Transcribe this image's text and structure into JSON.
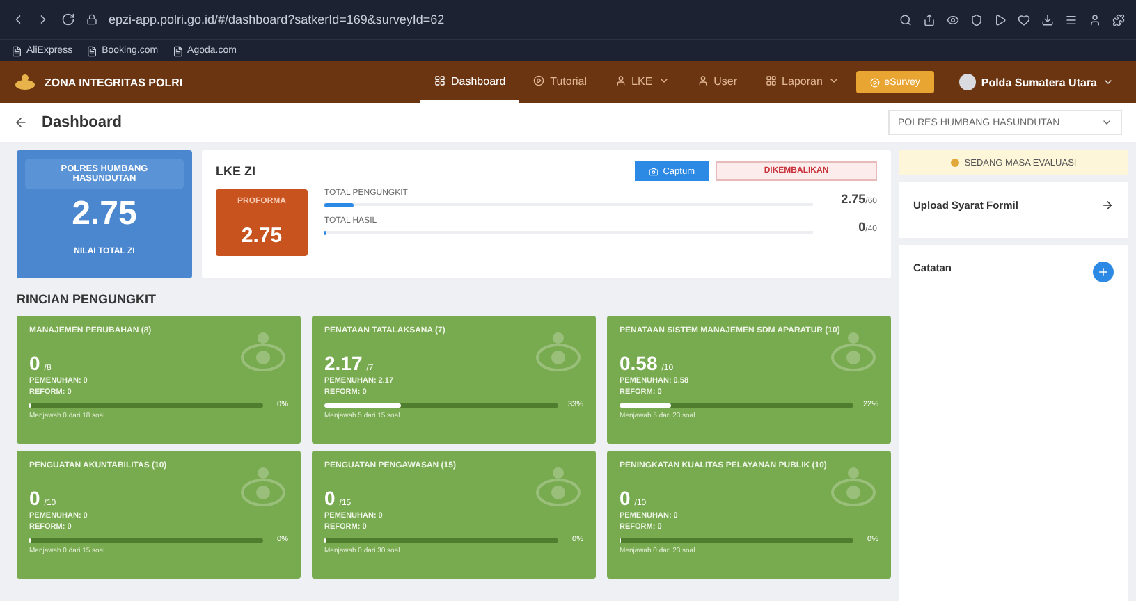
{
  "browser": {
    "address": "epzi-app.polri.go.id/#/dashboard?satkerId=169&surveyId=62",
    "bookmarks": [
      "AliExpress",
      "Booking.com",
      "Agoda.com"
    ]
  },
  "navbar": {
    "brand": "ZONA INTEGRITAS POLRI",
    "menu": [
      {
        "label": "Dashboard",
        "dropdown": false,
        "selected": true
      },
      {
        "label": "Tutorial",
        "dropdown": false,
        "selected": false
      },
      {
        "label": "LKE",
        "dropdown": true,
        "selected": false
      },
      {
        "label": "User",
        "dropdown": false,
        "selected": false
      },
      {
        "label": "Laporan",
        "dropdown": true,
        "selected": false
      }
    ],
    "survey_button": "eSurvey",
    "user": "Polda Sumatera Utara"
  },
  "header": {
    "title": "Dashboard",
    "unit_select": "POLRES HUMBANG HASUNDUTAN"
  },
  "summary": {
    "unit": "POLRES HUMBANG HASUNDUTAN",
    "score": "2.75",
    "caption": "NILAI TOTAL ZI"
  },
  "lke": {
    "title": "LKE ZI",
    "capture_button": "Captum",
    "status": "DIKEMBALIKAN",
    "proforma_label": "PROFORMA",
    "proforma_value": "2.75",
    "metrics": [
      {
        "label": "TOTAL PENGUNGKIT",
        "value": "2.75",
        "max": "/60",
        "level": 0.06
      },
      {
        "label": "TOTAL HASIL",
        "value": "0",
        "max": "/40",
        "level": 0
      }
    ]
  },
  "section_title": "RINCIAN PENGUNGKIT",
  "categories": [
    {
      "title": "MANAJEMEN PERUBAHAN (8)",
      "score": "0",
      "max": "/8",
      "pemenuhan": "PEMENUHAN: 0",
      "reform": "REFORM: 0",
      "level": 0,
      "percent": "0%",
      "answered": "Menjawab 0 dari 18 soal"
    },
    {
      "title": "PENATAAN TATALAKSANA (7)",
      "score": "2.17",
      "max": "/7",
      "pemenuhan": "PEMENUHAN: 2.17",
      "reform": "REFORM: 0",
      "level": 0.33,
      "percent": "33%",
      "answered": "Menjawab 5 dari 15 soal"
    },
    {
      "title": "PENATAAN SISTEM MANAJEMEN SDM APARATUR (10)",
      "score": "0.58",
      "max": "/10",
      "pemenuhan": "PEMENUHAN: 0.58",
      "reform": "REFORM: 0",
      "level": 0.22,
      "percent": "22%",
      "answered": "Menjawab 5 dari 23 soal"
    },
    {
      "title": "PENGUATAN AKUNTABILITAS (10)",
      "score": "0",
      "max": "/10",
      "pemenuhan": "PEMENUHAN: 0",
      "reform": "REFORM: 0",
      "level": 0,
      "percent": "0%",
      "answered": "Menjawab 0 dari 15 soal"
    },
    {
      "title": "PENGUATAN PENGAWASAN (15)",
      "score": "0",
      "max": "/15",
      "pemenuhan": "PEMENUHAN: 0",
      "reform": "REFORM: 0",
      "level": 0,
      "percent": "0%",
      "answered": "Menjawab 0 dari 30 soal"
    },
    {
      "title": "PENINGKATAN KUALITAS PELAYANAN PUBLIK (10)",
      "score": "0",
      "max": "/10",
      "pemenuhan": "PEMENUHAN: 0",
      "reform": "REFORM: 0",
      "level": 0,
      "percent": "0%",
      "answered": "Menjawab 0 dari 23 soal"
    }
  ],
  "side": {
    "status": "SEDANG MASA EVALUASI",
    "upload": "Upload Syarat Formil",
    "catatan": "Catatan"
  }
}
